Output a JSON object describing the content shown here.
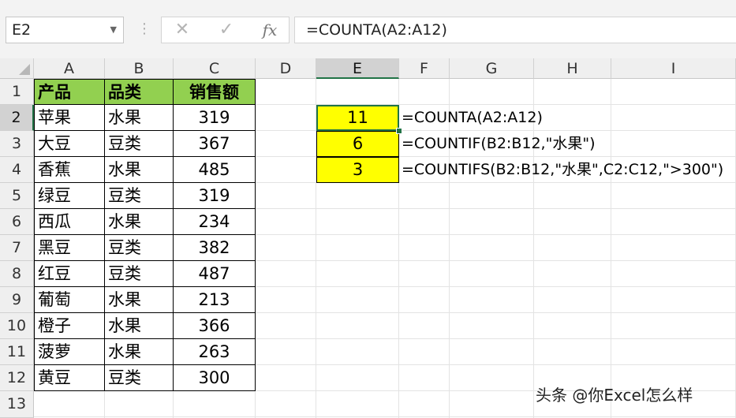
{
  "toolbar": {
    "name_box": "E2",
    "cancel_symbol": "✕",
    "enter_symbol": "✓",
    "fx_label": "fx",
    "formula": "=COUNTA(A2:A12)"
  },
  "columns": [
    "A",
    "B",
    "C",
    "D",
    "E",
    "F",
    "G",
    "H",
    "I"
  ],
  "rows": [
    "1",
    "2",
    "3",
    "4",
    "5",
    "6",
    "7",
    "8",
    "9",
    "10",
    "11",
    "12",
    "13"
  ],
  "table": {
    "headers": [
      "产品",
      "品类",
      "销售额"
    ],
    "data": [
      [
        "苹果",
        "水果",
        "319"
      ],
      [
        "大豆",
        "豆类",
        "367"
      ],
      [
        "香蕉",
        "水果",
        "485"
      ],
      [
        "绿豆",
        "豆类",
        "319"
      ],
      [
        "西瓜",
        "水果",
        "234"
      ],
      [
        "黑豆",
        "豆类",
        "382"
      ],
      [
        "红豆",
        "豆类",
        "487"
      ],
      [
        "葡萄",
        "水果",
        "213"
      ],
      [
        "橙子",
        "水果",
        "366"
      ],
      [
        "菠萝",
        "水果",
        "263"
      ],
      [
        "黄豆",
        "豆类",
        "300"
      ]
    ]
  },
  "results": [
    {
      "value": "11",
      "formula": "=COUNTA(A2:A12)"
    },
    {
      "value": "6",
      "formula": "=COUNTIF(B2:B12,\"水果\")"
    },
    {
      "value": "3",
      "formula": "=COUNTIFS(B2:B12,\"水果\",C2:C12,\">300\")"
    }
  ],
  "watermark": "头条 @你Excel怎么样",
  "colors": {
    "header_fill": "#92d050",
    "result_fill": "#ffff00",
    "selection": "#217346"
  }
}
